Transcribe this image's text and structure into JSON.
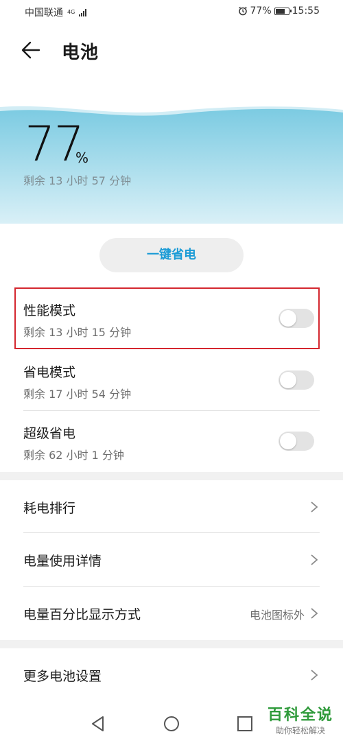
{
  "status_bar": {
    "carrier": "中国联通",
    "network": "4G",
    "battery_text": "77%",
    "battery_level": 0.77,
    "time": "15:55"
  },
  "header": {
    "title": "电池"
  },
  "battery": {
    "percent": "77",
    "percent_sign": "%",
    "remaining": "剩余 13 小时 57 分钟",
    "wave_color": "#7ccbe2"
  },
  "one_key_save": {
    "label": "一键省电"
  },
  "modes": [
    {
      "title": "性能模式",
      "subtitle": "剩余 13 小时 15 分钟",
      "enabled": false
    },
    {
      "title": "省电模式",
      "subtitle": "剩余 17 小时 54 分钟",
      "enabled": false
    },
    {
      "title": "超级省电",
      "subtitle": "剩余 62 小时 1 分钟",
      "enabled": false
    }
  ],
  "menu": [
    {
      "label": "耗电排行",
      "value": ""
    },
    {
      "label": "电量使用详情",
      "value": ""
    },
    {
      "label": "电量百分比显示方式",
      "value": "电池图标外"
    }
  ],
  "more": {
    "label": "更多电池设置"
  },
  "watermark": {
    "main": "百科全说",
    "sub": "助你轻松解决"
  },
  "colors": {
    "accent": "#1a9bd6",
    "highlight_border": "#d4262e",
    "watermark_green": "#2e9a3a"
  }
}
